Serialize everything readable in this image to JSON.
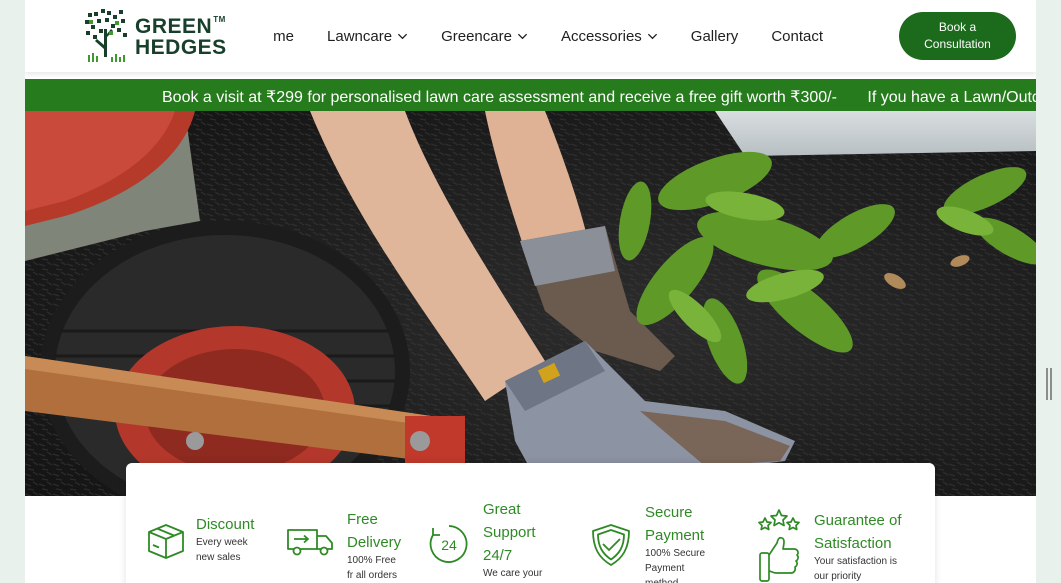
{
  "brand": {
    "line1": "GREEN",
    "line2": "HEDGES",
    "tm": "TM"
  },
  "nav": {
    "items": [
      {
        "label": "Home",
        "has_dropdown": false
      },
      {
        "label": "Lawncare",
        "has_dropdown": true
      },
      {
        "label": "Greencare",
        "has_dropdown": true
      },
      {
        "label": "Accessories",
        "has_dropdown": true
      },
      {
        "label": "Gallery",
        "has_dropdown": false
      },
      {
        "label": "Contact",
        "has_dropdown": false
      }
    ],
    "cta_line1": "Book a",
    "cta_line2": "Consultation"
  },
  "ticker": {
    "message1": "Book a visit at ₹299 for personalised lawn care assessment and receive a free gift worth ₹300/-",
    "message2": "If you have a Lawn/Outdo"
  },
  "hero": {
    "icon": "gardener-planting-photo"
  },
  "features": [
    {
      "title": "Discount",
      "sub1": "Every week",
      "sub2": "new sales",
      "icon": "box-icon"
    },
    {
      "title": "Free Delivery",
      "title1": "Free",
      "title2": "Delivery",
      "sub1": "100% Free",
      "sub2": "fr all orders",
      "icon": "truck-icon"
    },
    {
      "title": "Great Support 24/7",
      "title1": "Great",
      "title2": "Support",
      "title3": "24/7",
      "sub1": "We care your",
      "icon": "support-24-icon"
    },
    {
      "title": "Secure Payment",
      "title1": "Secure",
      "title2": "Payment",
      "sub1": "100% Secure",
      "sub2": "Payment",
      "sub3": "method",
      "icon": "shield-check-icon"
    },
    {
      "title": "Guarantee of Satisfaction",
      "title1": "Guarantee of",
      "title2": "Satisfaction",
      "sub1": "Your satisfaction is",
      "sub2": "our priority",
      "icon": "thumbs-up-stars-icon"
    }
  ],
  "colors": {
    "brand_green": "#1c6a1c",
    "ticker_green": "#267c1d",
    "feature_green": "#2f8a26",
    "logo_dark": "#173f2a"
  }
}
